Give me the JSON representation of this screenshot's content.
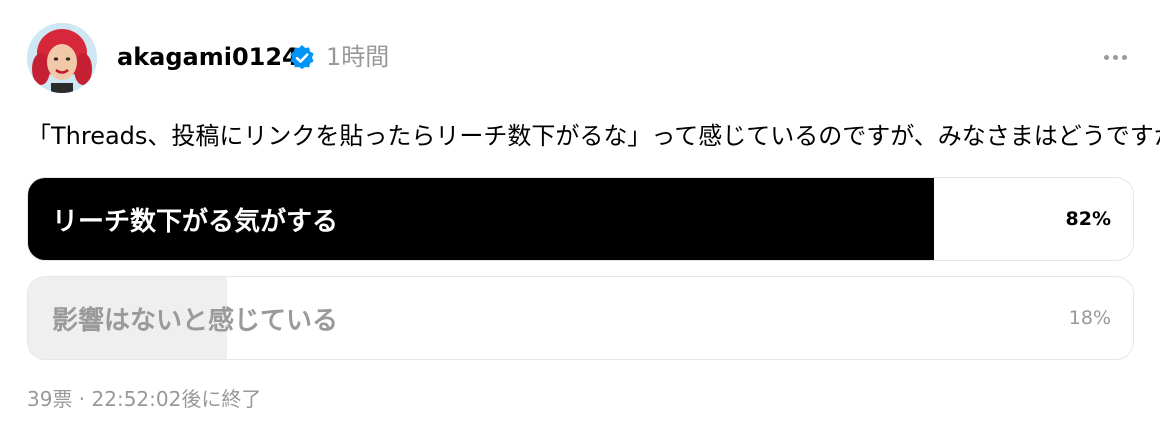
{
  "post": {
    "username": "akagami0124",
    "time_ago": "1時間",
    "text": "「Threads、投稿にリンクを貼ったらリーチ数下がるな」って感じているのですが、みなさまはどうですか？"
  },
  "icons": {
    "avatar": "avatar",
    "verified": "verified-badge-icon",
    "more": "more-options-icon"
  },
  "poll": {
    "options": [
      {
        "label": "リーチ数下がる気がする",
        "percent_label": "82%",
        "percent": 82
      },
      {
        "label": "影響はないと感じている",
        "percent_label": "18%",
        "percent": 18
      }
    ],
    "footer": "39票 · 22:52:02後に終了"
  },
  "colors": {
    "winner_fill": "#000000",
    "loser_fill": "#efefef",
    "verified": "#0095f6",
    "muted_text": "#999999"
  }
}
